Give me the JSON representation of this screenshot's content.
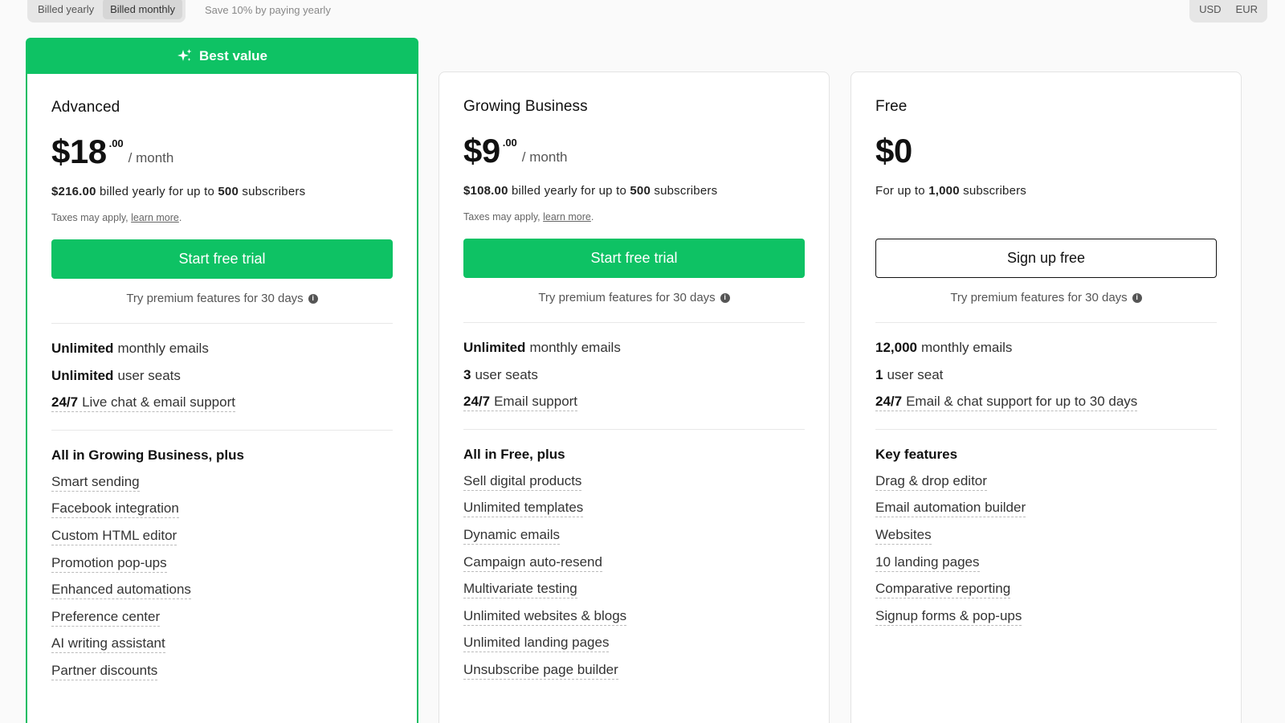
{
  "top": {
    "billing_options": [
      "Billed yearly",
      "Billed monthly"
    ],
    "save_note": "Save 10% by paying yearly",
    "currency_options": [
      "USD",
      "EUR"
    ]
  },
  "colors": {
    "brand_green": "#0ec264",
    "text": "#111111"
  },
  "plans": [
    {
      "banner": "Best value",
      "name": "Advanced",
      "price_main": "$18",
      "price_cents": ".00",
      "price_per": "/ month",
      "billed_amount": "$216.00",
      "billed_mid": " billed yearly for up to ",
      "billed_count": "500",
      "billed_tail": " subscribers",
      "taxes_text": "Taxes may apply, ",
      "taxes_link": "learn more",
      "cta": "Start free trial",
      "trial_note": "Try premium features for 30 days",
      "stats": [
        {
          "bold": "Unlimited",
          "rest": "monthly emails"
        },
        {
          "bold": "Unlimited",
          "rest": "user seats"
        },
        {
          "bold": "24/7",
          "rest": "Live chat & email support"
        }
      ],
      "features_title": "All in Growing Business, plus",
      "features": [
        "Smart sending",
        "Facebook integration",
        "Custom HTML editor",
        "Promotion pop-ups",
        "Enhanced automations",
        "Preference center",
        "AI writing assistant",
        "Partner discounts"
      ]
    },
    {
      "name": "Growing Business",
      "price_main": "$9",
      "price_cents": ".00",
      "price_per": "/ month",
      "billed_amount": "$108.00",
      "billed_mid": " billed yearly for up to ",
      "billed_count": "500",
      "billed_tail": " subscribers",
      "taxes_text": "Taxes may apply, ",
      "taxes_link": "learn more",
      "cta": "Start free trial",
      "trial_note": "Try premium features for 30 days",
      "stats": [
        {
          "bold": "Unlimited",
          "rest": "monthly emails"
        },
        {
          "bold": "3",
          "rest": "user seats"
        },
        {
          "bold": "24/7",
          "rest": "Email support"
        }
      ],
      "features_title": "All in Free, plus",
      "features": [
        "Sell digital products",
        "Unlimited templates",
        "Dynamic emails",
        "Campaign auto-resend",
        "Multivariate testing",
        "Unlimited websites & blogs",
        "Unlimited landing pages",
        "Unsubscribe page builder"
      ]
    },
    {
      "name": "Free",
      "price_main": "$0",
      "billed_prefix": "For up to ",
      "billed_count": "1,000",
      "billed_tail": " subscribers",
      "cta": "Sign up free",
      "trial_note": "Try premium features for 30 days",
      "stats": [
        {
          "bold": "12,000",
          "rest": "monthly emails"
        },
        {
          "bold": "1",
          "rest": "user seat"
        },
        {
          "bold": "24/7",
          "rest": "Email & chat support for up to 30 days"
        }
      ],
      "features_title": "Key features",
      "features": [
        "Drag & drop editor",
        "Email automation builder",
        "Websites",
        "10 landing pages",
        "Comparative reporting",
        "Signup forms & pop-ups"
      ]
    }
  ]
}
